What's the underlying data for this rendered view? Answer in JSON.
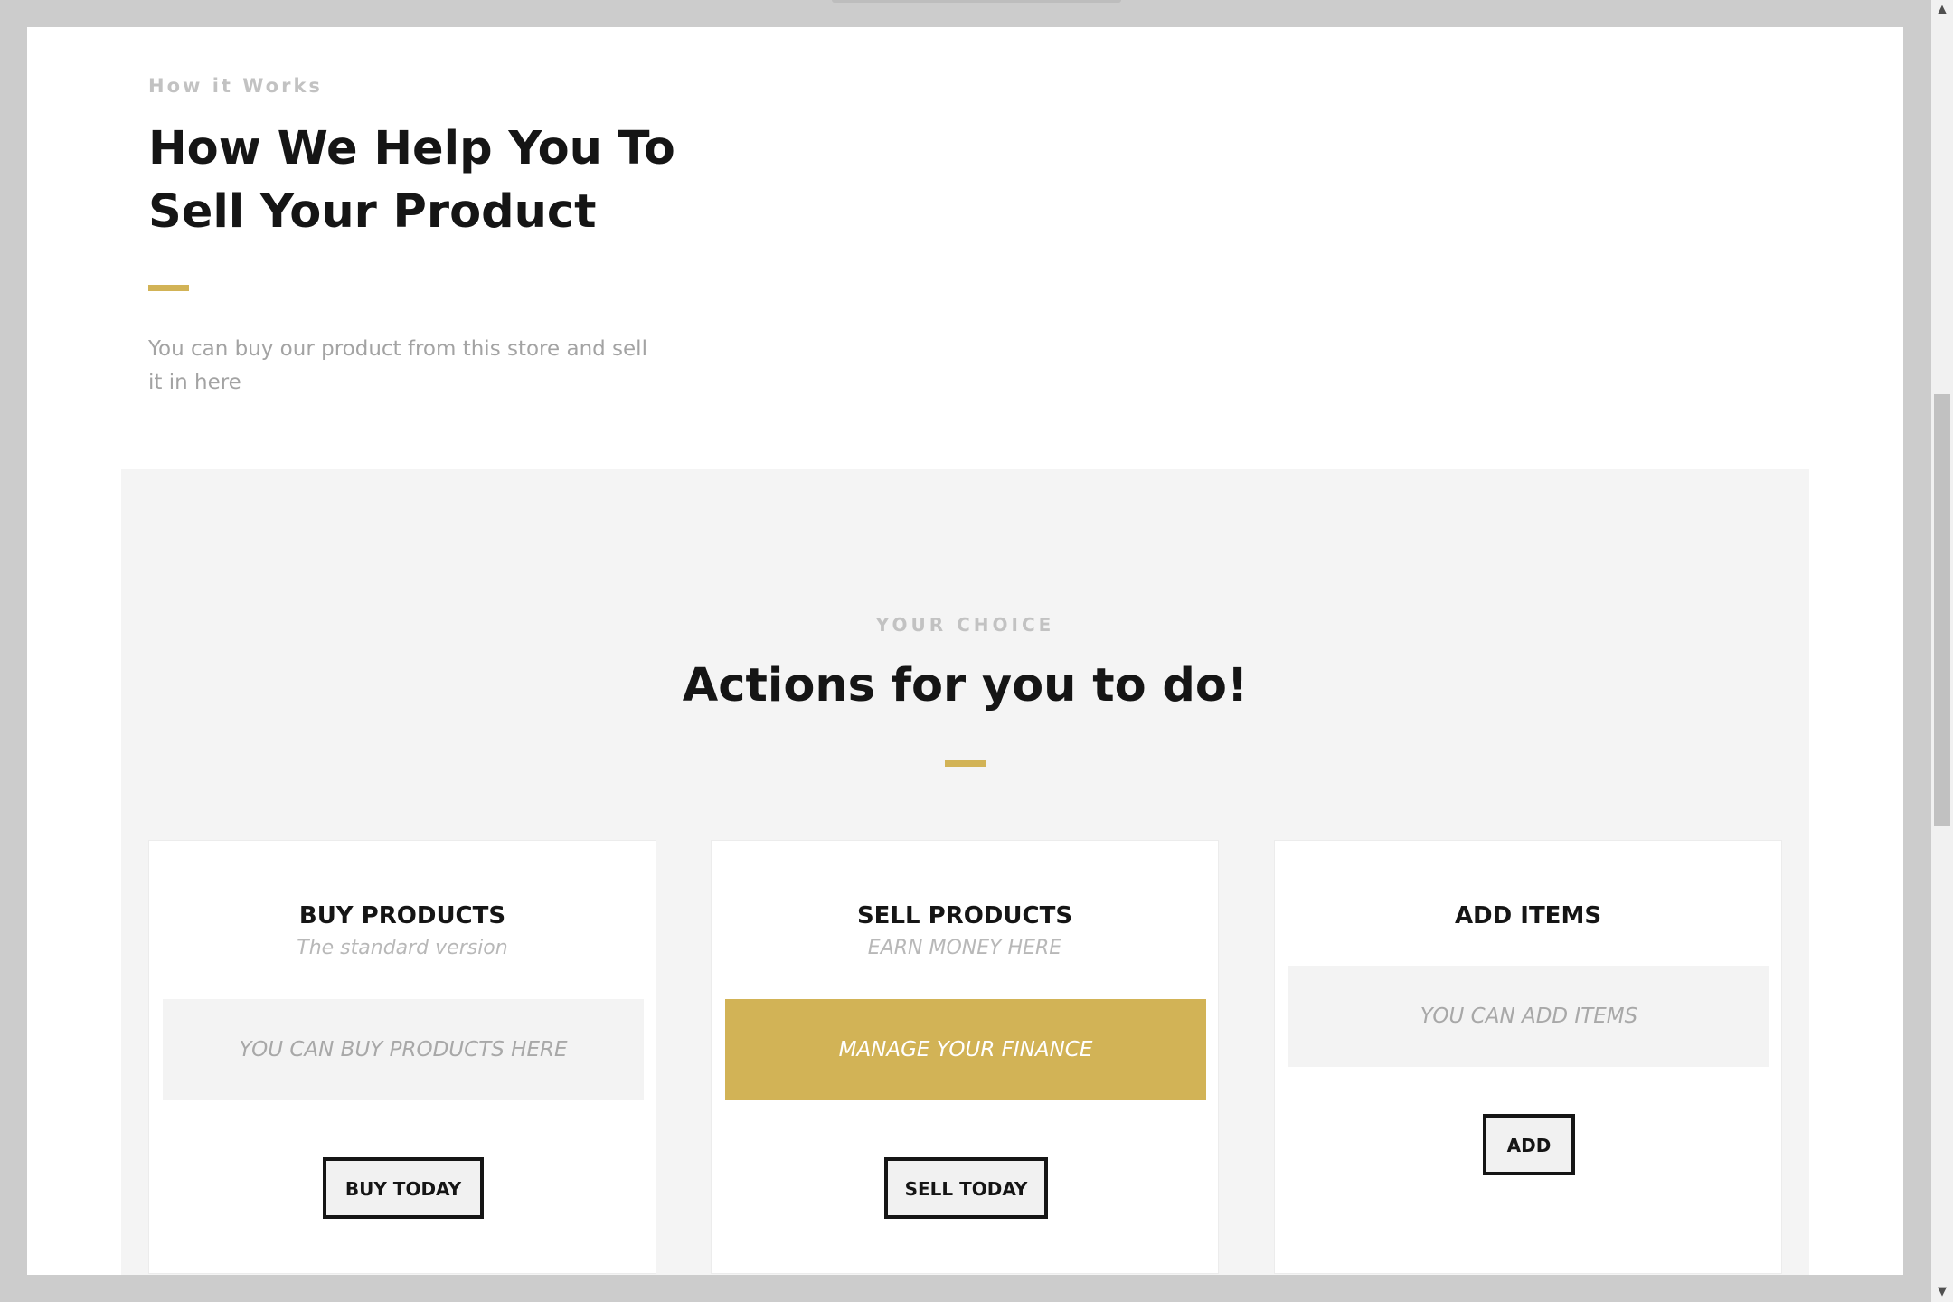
{
  "how_it_works": {
    "eyebrow": "How it Works",
    "title_line1": "How We Help You To",
    "title_line2": "Sell Your Product",
    "description": "You can buy our product from this store and sell it in here"
  },
  "choice": {
    "eyebrow": "YOUR CHOICE",
    "title": "Actions for you to do!"
  },
  "cards": [
    {
      "title": "BUY PRODUCTS",
      "subtitle": "The standard version",
      "band": "YOU CAN BUY PRODUCTS HERE",
      "button": "BUY TODAY"
    },
    {
      "title": "SELL PRODUCTS",
      "subtitle": "EARN MONEY HERE",
      "band": "MANAGE YOUR FINANCE",
      "button": "SELL TODAY"
    },
    {
      "title": "ADD ITEMS",
      "subtitle": "",
      "band": "YOU CAN ADD ITEMS",
      "button": "ADD"
    }
  ],
  "colors": {
    "accent": "#d2b356",
    "heading": "#151515",
    "muted": "#a3a3a3",
    "section_bg": "#f4f4f4",
    "window_bg": "#cccccc"
  },
  "icons": {
    "scroll_up": "scroll-up-arrow-icon",
    "scroll_down": "scroll-down-arrow-icon"
  }
}
